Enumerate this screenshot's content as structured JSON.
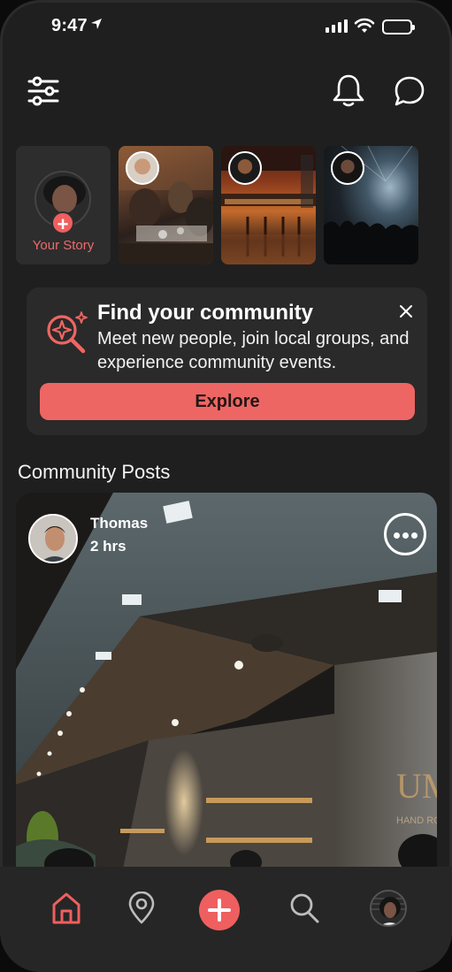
{
  "status_bar": {
    "time": "9:47"
  },
  "stories": {
    "my_story_label": "Your Story"
  },
  "community_card": {
    "title": "Find your community",
    "description": "Meet new people, join local  groups, and experience community events.",
    "button_label": "Explore"
  },
  "section": {
    "title": "Community Posts"
  },
  "post": {
    "author": "Thomas",
    "time": "2 hrs",
    "sign_text": "UM",
    "sign_subtext": "HAND ROLL"
  },
  "colors": {
    "accent": "#ee6663",
    "background": "#1f1f1f",
    "card": "#2a2a2a",
    "tabbar": "#262626"
  },
  "icons": {
    "header": [
      "filter-sliders-icon",
      "bell-icon",
      "chat-bubble-icon"
    ],
    "tabbar": [
      "home-icon",
      "map-pin-icon",
      "add-icon",
      "search-icon",
      "profile-avatar"
    ]
  }
}
